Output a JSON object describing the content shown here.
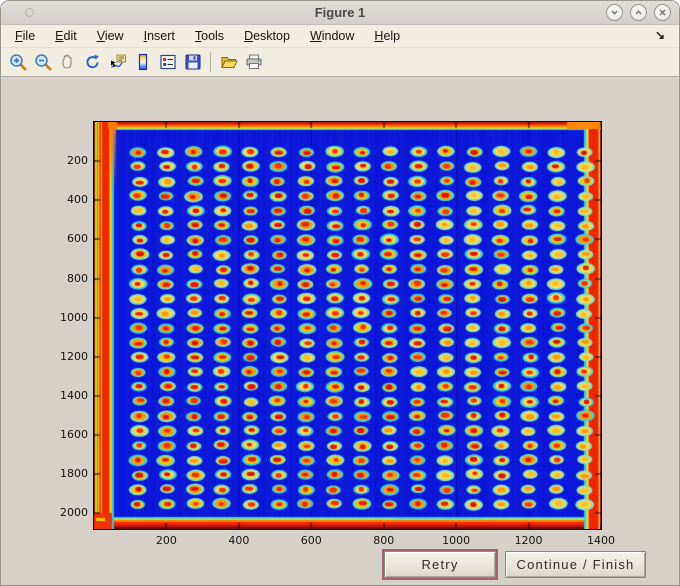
{
  "window": {
    "title": "Figure 1",
    "controls": [
      "shade",
      "unshade",
      "close"
    ]
  },
  "menu": {
    "items": [
      "File",
      "Edit",
      "View",
      "Insert",
      "Tools",
      "Desktop",
      "Window",
      "Help"
    ],
    "dock_icon": "↘"
  },
  "toolbar": {
    "buttons": [
      "zoom-in",
      "zoom-out",
      "pan",
      "rotate-3d",
      "data-cursor",
      "insert-colorbar",
      "insert-legend",
      "save-figure",
      "open-file",
      "print-figure"
    ]
  },
  "action_buttons": {
    "retry_label": "Retry",
    "continue_label": "Continue / Finish"
  },
  "chart_data": {
    "type": "heatmap",
    "title": "",
    "xlabel": "",
    "ylabel": "",
    "xlim": [
      0,
      1400
    ],
    "ylim": [
      0,
      2080
    ],
    "y_axis_direction": "reversed",
    "xticks": [
      200,
      400,
      600,
      800,
      1000,
      1200,
      1400
    ],
    "yticks": [
      200,
      400,
      600,
      800,
      1000,
      1200,
      1400,
      1600,
      1800,
      2000
    ],
    "colormap": "jet",
    "grid_on": false,
    "background_color": "#0a15d8",
    "tick_color": "#000000",
    "spot_grid": {
      "rows": 25,
      "cols": 17,
      "x0_data": 124,
      "y0_data": 153,
      "dx_data": 77,
      "dy_data": 75,
      "core_colors_strong": [
        "#e81c00",
        "#dc1400",
        "#f53000"
      ],
      "core_colors_weak": [
        "#ff9900",
        "#ffbb22"
      ],
      "ring_colors": [
        "#ffc400",
        "#ffd84d",
        "#ff9d00"
      ],
      "halo_colors": [
        "#33d4e6",
        "#5ce0c0",
        "#7de6c8"
      ]
    },
    "faint_vlines_x": [
      400,
      600,
      1000,
      1200
    ],
    "edge_bands": {
      "left": [
        [
          "#7a1000",
          1
        ],
        [
          "#e8d23c",
          1
        ],
        [
          "#b0e040",
          1
        ],
        [
          "#ff5400",
          1
        ],
        [
          "#ffdc00",
          1
        ],
        [
          "#ff3c00",
          2
        ],
        [
          "#ffc800",
          1
        ],
        [
          "#f02800",
          7
        ],
        [
          "#ff7800",
          1
        ],
        [
          "#ffe400",
          1
        ],
        [
          "#7ce070",
          1
        ],
        [
          "#2cc8e8",
          2
        ]
      ],
      "right": [
        [
          "#8a1400",
          1
        ],
        [
          "#ffd83c",
          1
        ],
        [
          "#ff6a00",
          1
        ],
        [
          "#f02400",
          9
        ],
        [
          "#ff8c00",
          1
        ],
        [
          "#ffe400",
          1
        ],
        [
          "#8ce080",
          1
        ],
        [
          "#30cce8",
          2
        ]
      ],
      "top": [
        [
          "#a51600",
          1
        ],
        [
          "#f02800",
          2
        ],
        [
          "#ff7a00",
          2
        ],
        [
          "#ffc400",
          1
        ],
        [
          "#bce84c",
          1
        ],
        [
          "#38cce8",
          1
        ]
      ],
      "bottom": [
        [
          "#6e0c00",
          2
        ],
        [
          "#c01400",
          2
        ],
        [
          "#f02800",
          3
        ],
        [
          "#ff7a00",
          2
        ],
        [
          "#ffd400",
          1
        ],
        [
          "#6ee088",
          1
        ],
        [
          "#2cc8e8",
          1
        ]
      ]
    }
  }
}
